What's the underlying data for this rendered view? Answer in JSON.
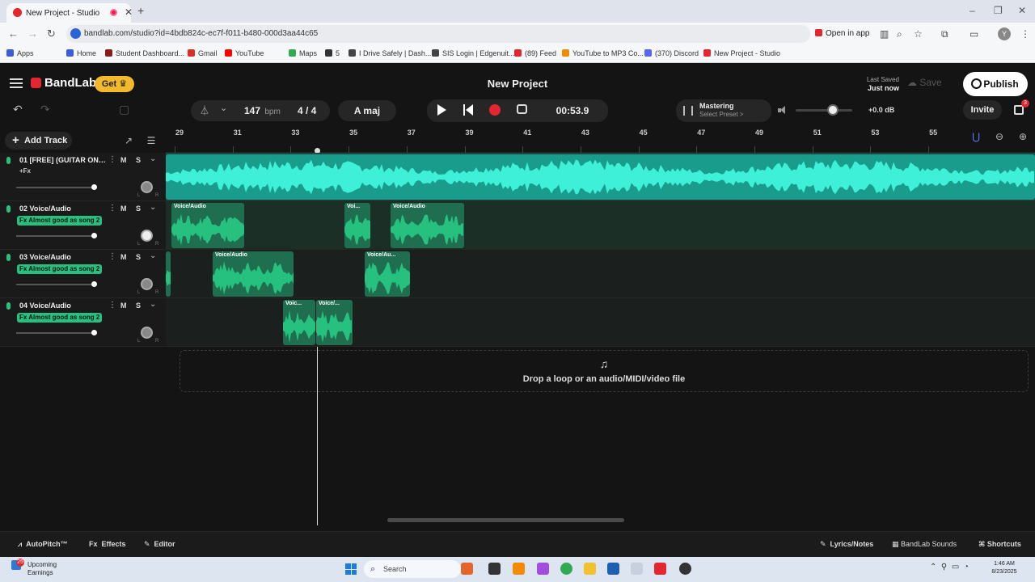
{
  "browser": {
    "tab_title": "New Project - Studio",
    "new_tab": "+",
    "url": "bandlab.com/studio?id=4bdb824c-ec7f-f011-b480-000d3aa44c65",
    "open_in_app": "Open in app",
    "profile_initial": "Y",
    "bookmarks": [
      "Apps",
      "Home",
      "Student Dashboard...",
      "Gmail",
      "YouTube",
      "Maps",
      "5",
      "I Drive Safely | Dash...",
      "SIS Login | Edgenuit...",
      "(89) Feed",
      "YouTube to MP3 Co...",
      "(370) Discord",
      "New Project - Studio"
    ],
    "bookmark_colors": [
      "#3b5bdb",
      "#3b5bdb",
      "#8a1c1c",
      "#d93025",
      "#ff0000",
      "#34a853",
      "#333333",
      "#444444",
      "#444444",
      "#e3262f",
      "#f28b00",
      "#5865f2",
      "#e3262f"
    ]
  },
  "header": {
    "brand": "BandLab",
    "get_label": "Get",
    "project_title": "New Project",
    "last_saved_label": "Last Saved",
    "last_saved_value": "Just now",
    "save_label": "Save",
    "publish_label": "Publish"
  },
  "toolbar": {
    "bpm_value": "147",
    "bpm_unit": "bpm",
    "time_signature": "4 / 4",
    "key": "A maj",
    "time": "00:53.9",
    "mastering_label": "Mastering",
    "mastering_preset": "Select Preset >",
    "volume_db": "+0.0 dB",
    "invite_label": "Invite",
    "gift_badge": "3"
  },
  "tracks_panel": {
    "add_track_label": "Add Track"
  },
  "ruler": {
    "bars": [
      "29",
      "31",
      "33",
      "35",
      "37",
      "39",
      "41",
      "43",
      "45",
      "47",
      "49",
      "51",
      "53",
      "55"
    ]
  },
  "tracks": [
    {
      "name": "01 [FREE] (GUITAR ONE) ...",
      "fx": "+Fx",
      "fx_active": false,
      "m": "M",
      "s": "S",
      "l": "L",
      "r": "R"
    },
    {
      "name": "02 Voice/Audio",
      "fx": "Fx Almost good as song 2",
      "fx_active": true,
      "m": "M",
      "s": "S",
      "l": "L",
      "r": "R"
    },
    {
      "name": "03 Voice/Audio",
      "fx": "Fx Almost good as song 2",
      "fx_active": true,
      "m": "M",
      "s": "S",
      "l": "L",
      "r": "R"
    },
    {
      "name": "04 Voice/Audio",
      "fx": "Fx Almost good as song 2",
      "fx_active": true,
      "m": "M",
      "s": "S",
      "l": "L",
      "r": "R"
    }
  ],
  "clips": {
    "track2": [
      "Voice/Audio",
      "Voi...",
      "Voice/Audio"
    ],
    "track3": [
      "Voice/Audio",
      "Voice/Au..."
    ],
    "track4": [
      "Voic...",
      "Voice/..."
    ]
  },
  "drop_zone": {
    "text": "Drop a loop or an audio/MIDI/video file"
  },
  "bottom_bar": {
    "autopitch": "AutoPitch™",
    "effects": "Effects",
    "editor": "Editor",
    "lyrics": "Lyrics/Notes",
    "sounds": "BandLab Sounds",
    "shortcuts": "Shortcuts"
  },
  "taskbar": {
    "weather_title": "Upcoming",
    "weather_sub": "Earnings",
    "weather_badge": "25",
    "search_placeholder": "Search",
    "time": "1:46 AM",
    "date": "8/23/2025"
  },
  "colors": {
    "accent_green": "#27c17f",
    "clip_green": "#1e6e4f",
    "track1_teal": "#1a9c8c",
    "record_red": "#e3262f",
    "get_gold": "#f2b92c"
  }
}
